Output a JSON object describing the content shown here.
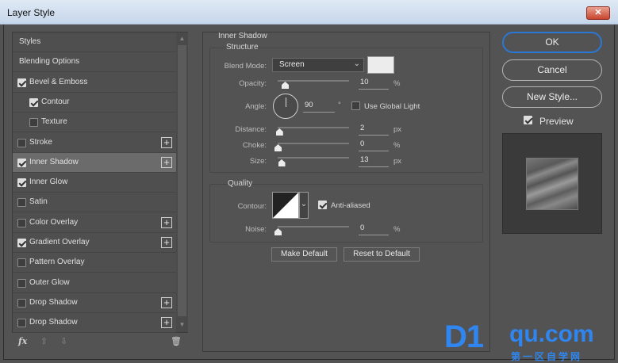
{
  "window": {
    "title": "Layer Style",
    "close_label": "✕"
  },
  "sidebar": {
    "items": [
      {
        "label": "Styles",
        "check": null,
        "plus": false
      },
      {
        "label": "Blending Options",
        "check": null,
        "plus": false
      },
      {
        "label": "Bevel & Emboss",
        "check": true,
        "plus": false
      },
      {
        "label": "Contour",
        "check": true,
        "plus": false,
        "indent": true
      },
      {
        "label": "Texture",
        "check": false,
        "plus": false,
        "indent": true
      },
      {
        "label": "Stroke",
        "check": false,
        "plus": true
      },
      {
        "label": "Inner Shadow",
        "check": true,
        "plus": true,
        "active": true
      },
      {
        "label": "Inner Glow",
        "check": true,
        "plus": false
      },
      {
        "label": "Satin",
        "check": false,
        "plus": false
      },
      {
        "label": "Color Overlay",
        "check": false,
        "plus": true
      },
      {
        "label": "Gradient Overlay",
        "check": true,
        "plus": true
      },
      {
        "label": "Pattern Overlay",
        "check": false,
        "plus": false
      },
      {
        "label": "Outer Glow",
        "check": false,
        "plus": false
      },
      {
        "label": "Drop Shadow",
        "check": false,
        "plus": true
      },
      {
        "label": "Drop Shadow",
        "check": false,
        "plus": true
      }
    ],
    "bottom": {
      "fx": "fx",
      "up": "⇧",
      "down": "⇩",
      "trash": "🗑"
    }
  },
  "inner_shadow": {
    "title": "Inner Shadow",
    "structure": {
      "title": "Structure",
      "blend_mode_label": "Blend Mode:",
      "blend_mode": "Screen",
      "opacity_label": "Opacity:",
      "opacity": "10",
      "opacity_unit": "%",
      "opacity_fraction": 0.1,
      "angle_label": "Angle:",
      "angle": "90",
      "angle_unit": "°",
      "global_light_label": "Use Global Light",
      "global_light": false,
      "distance_label": "Distance:",
      "distance": "2",
      "distance_unit": "px",
      "distance_fraction": 0.02,
      "choke_label": "Choke:",
      "choke": "0",
      "choke_unit": "%",
      "choke_fraction": 0.0,
      "size_label": "Size:",
      "size": "13",
      "size_unit": "px",
      "size_fraction": 0.05
    },
    "quality": {
      "title": "Quality",
      "contour_label": "Contour:",
      "anti_aliased_label": "Anti-aliased",
      "anti_aliased": true,
      "noise_label": "Noise:",
      "noise": "0",
      "noise_unit": "%",
      "noise_fraction": 0.0
    },
    "make_default": "Make Default",
    "reset_default": "Reset to Default"
  },
  "actions": {
    "ok": "OK",
    "cancel": "Cancel",
    "new_style": "New Style...",
    "preview_label": "Preview",
    "preview": true
  },
  "watermark": {
    "logo": "D1",
    "url": "qu.com",
    "cn": "第一区自学网"
  },
  "colors": {
    "accent": "#2a78d6",
    "watermark": "#2f86f0",
    "panel": "#535353"
  }
}
